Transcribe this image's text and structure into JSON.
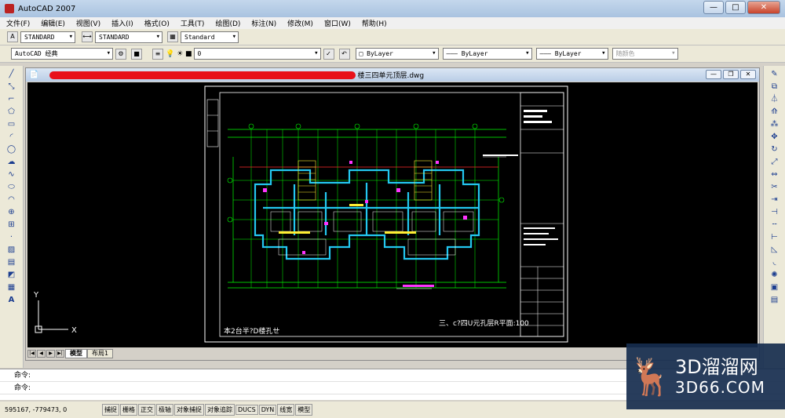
{
  "app": {
    "title": "AutoCAD 2007",
    "win_min": "—",
    "win_max": "□",
    "win_close": "✕"
  },
  "menu": [
    "文件(F)",
    "编辑(E)",
    "视图(V)",
    "插入(I)",
    "格式(O)",
    "工具(T)",
    "绘图(D)",
    "标注(N)",
    "修改(M)",
    "窗口(W)",
    "帮助(H)"
  ],
  "styles": {
    "text_style": "STANDARD",
    "dim_style": "STANDARD",
    "table_style": "Standard"
  },
  "layers": {
    "workspace": "AutoCAD 经典",
    "current_layer": "0",
    "color": "ByLayer",
    "linetype": "ByLayer",
    "lineweight": "ByLayer",
    "plotstyle": "随颜色"
  },
  "document": {
    "name_visible": "楼三四单元顶层.dwg",
    "drawing_title": "三、c?四U元孔层R平面:100",
    "left_note": "本2台半?D楼孔ㄝ",
    "tabs": [
      "模型",
      "布局1"
    ]
  },
  "ucs": {
    "y_label": "Y",
    "x_label": "X"
  },
  "command": {
    "line1": "命令:",
    "line2": "命令:"
  },
  "status": {
    "coords": "595167, -779473, 0",
    "buttons": [
      "捕捉",
      "栅格",
      "正交",
      "极轴",
      "对象捕捉",
      "对象追踪",
      "DUCS",
      "DYN",
      "线宽",
      "模型"
    ]
  },
  "watermark": {
    "brand_cn": "3D溜溜网",
    "site": "3D66.COM"
  },
  "colors": {
    "canvas": "#000000",
    "paper": "#000000",
    "wall": "#23c7f0",
    "grid": "#00ff00",
    "text": "#ffffff",
    "redact": "#e8101a"
  }
}
